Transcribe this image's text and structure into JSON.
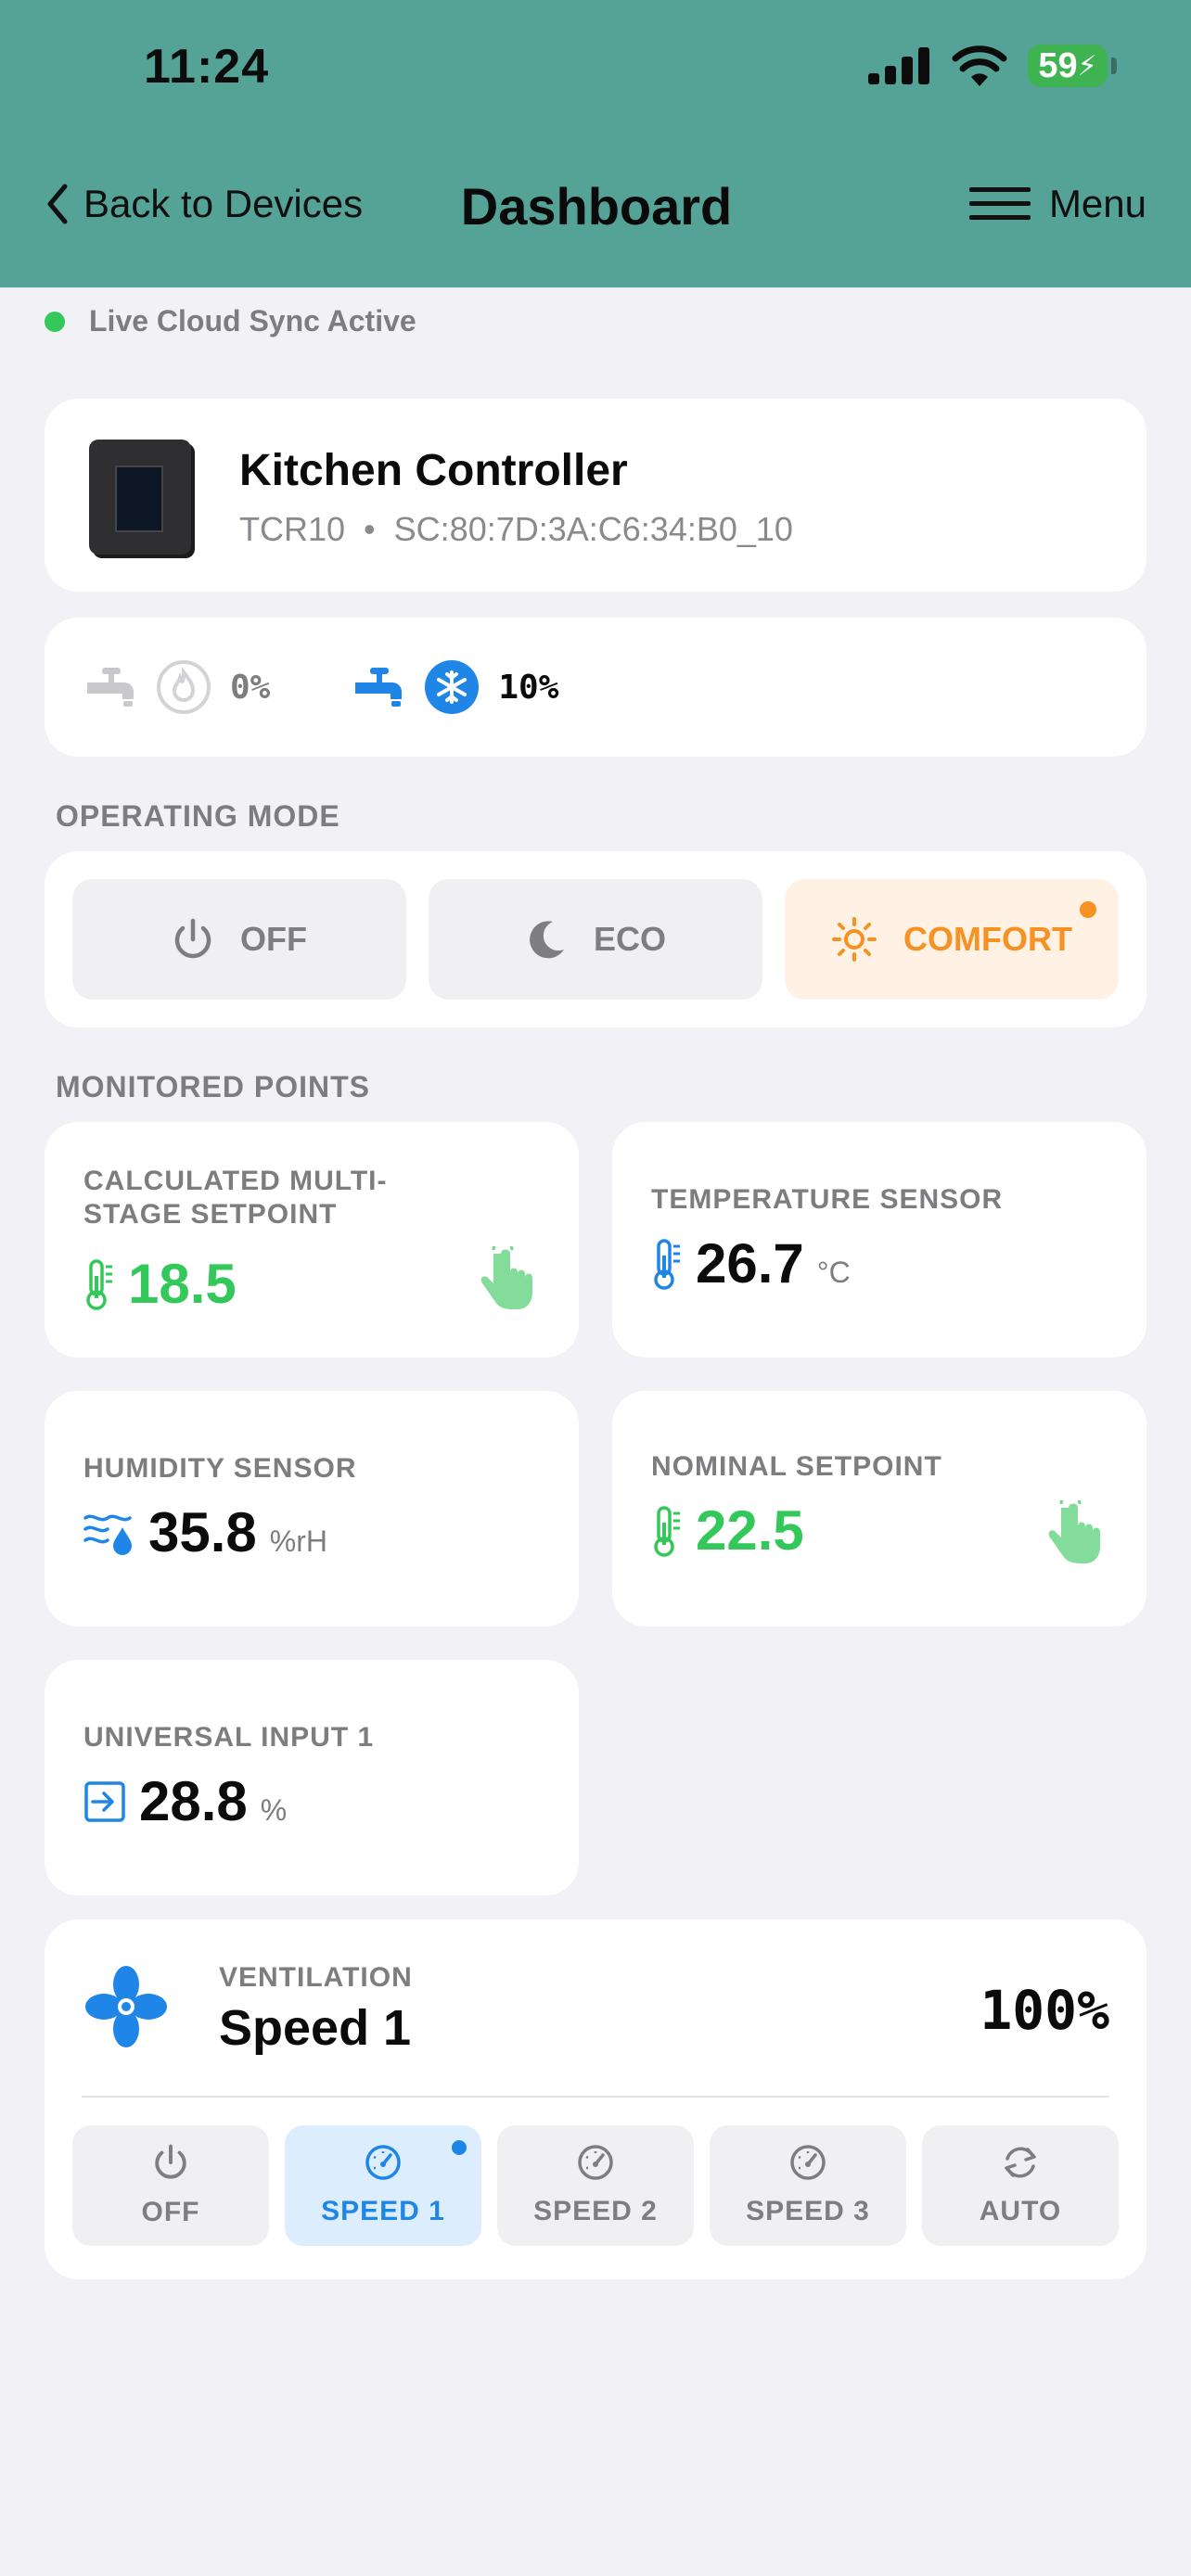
{
  "status_bar": {
    "time": "11:24",
    "battery": "59"
  },
  "nav": {
    "back_label": "Back to Devices",
    "title": "Dashboard",
    "menu_label": "Menu"
  },
  "sync": {
    "text": "Live Cloud Sync Active"
  },
  "device": {
    "name": "Kitchen Controller",
    "model": "TCR10",
    "serial": "SC:80:7D:3A:C6:34:B0_10",
    "separator": "•"
  },
  "valves": [
    {
      "type": "heating",
      "value": "0%"
    },
    {
      "type": "cooling",
      "value": "10%"
    }
  ],
  "operating_mode": {
    "label": "OPERATING MODE",
    "options": [
      {
        "label": "OFF",
        "icon": "power-icon"
      },
      {
        "label": "ECO",
        "icon": "moon-icon"
      },
      {
        "label": "COMFORT",
        "icon": "sun-icon",
        "selected": true
      }
    ]
  },
  "monitored": {
    "label": "MONITORED POINTS",
    "points": [
      {
        "label": "Calculated Multi-Stage Setpoint",
        "value": "18.5",
        "unit": "",
        "icon": "thermometer-icon",
        "editable": true
      },
      {
        "label": "Temperature Sensor",
        "value": "26.7",
        "unit": "°C",
        "icon": "thermometer-icon"
      },
      {
        "label": "Humidity Sensor",
        "value": "35.8",
        "unit": "%rH",
        "icon": "humidity-icon"
      },
      {
        "label": "Nominal Setpoint",
        "value": "22.5",
        "unit": "",
        "icon": "thermometer-icon",
        "editable": true
      },
      {
        "label": "Universal Input 1",
        "value": "28.8",
        "unit": "%",
        "icon": "input-icon"
      }
    ]
  },
  "ventilation": {
    "label": "VENTILATION",
    "value": "Speed 1",
    "percent": "100%",
    "options": [
      {
        "label": "OFF",
        "icon": "power-icon"
      },
      {
        "label": "SPEED 1",
        "icon": "gauge-icon",
        "selected": true
      },
      {
        "label": "SPEED 2",
        "icon": "gauge-icon"
      },
      {
        "label": "SPEED 3",
        "icon": "gauge-icon"
      },
      {
        "label": "AUTO",
        "icon": "refresh-icon"
      }
    ]
  },
  "colors": {
    "header": "#55a297",
    "accent_green": "#34c759",
    "accent_blue": "#1f86e8",
    "accent_orange": "#f59223"
  }
}
